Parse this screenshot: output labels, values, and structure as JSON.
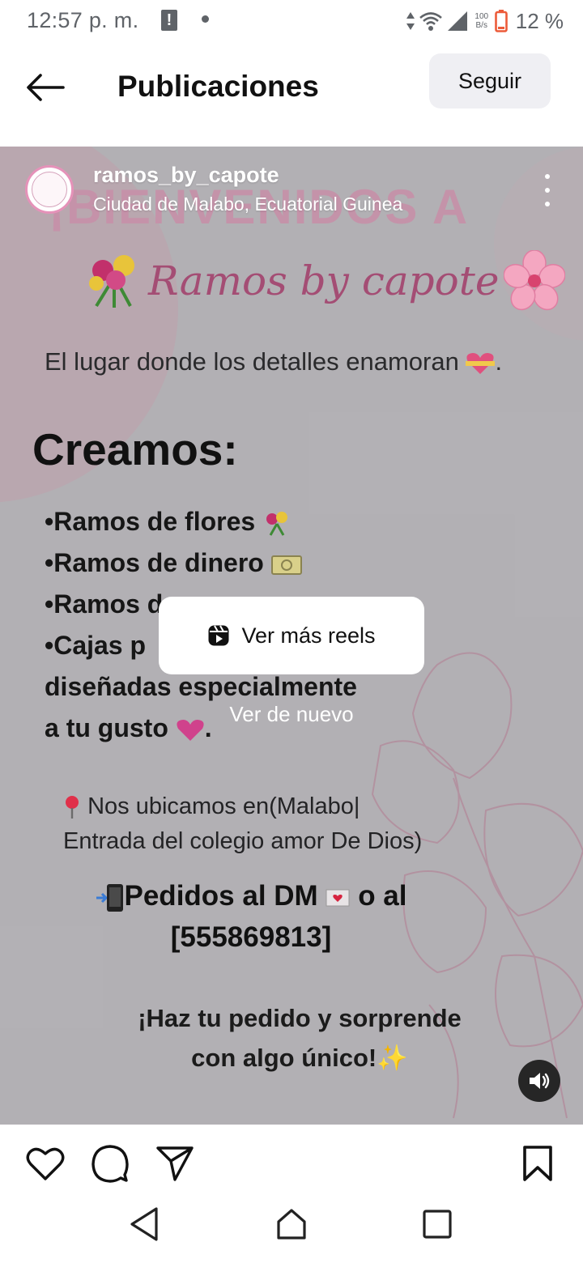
{
  "status_bar": {
    "time": "12:57 p. m.",
    "alert_glyph": "!",
    "net_speed_value": "100",
    "net_speed_unit": "B/s",
    "battery_percent": "12 %",
    "icons": [
      "alert-icon",
      "data-arrows-icon",
      "wifi-icon",
      "signal-icon",
      "battery-low-icon"
    ]
  },
  "header": {
    "title": "Publicaciones",
    "follow_label": "Seguir",
    "back_icon": "arrow-left-icon"
  },
  "post": {
    "username": "ramos_by_capote",
    "location": "Ciudad de Malabo, Ecuatorial Guinea",
    "image": {
      "welcome": "¡BIENVENIDOS A",
      "brand": "Ramos by capote",
      "tagline": "El lugar donde los detalles enamoran",
      "heading": "Creamos:",
      "services": [
        "•Ramos de flores",
        "•Ramos de dinero",
        "•Ramos d",
        "•Cajas p"
      ],
      "services_tail": [
        "diseñadas especialmente",
        "a tu gusto"
      ],
      "location_lines": [
        "Nos ubicamos en(Malabo|",
        "Entrada del colegio amor De Dios)"
      ],
      "orders_lines": [
        "Pedidos al DM",
        "o al",
        "[555869813]"
      ],
      "cta_lines": [
        "¡Haz tu pedido y sorprende",
        "con algo único!"
      ]
    },
    "overlay": {
      "reels_label": "Ver más reels",
      "replay_label": "Ver de nuevo"
    }
  },
  "actions": {
    "icons": [
      "heart-icon",
      "comment-icon",
      "share-icon",
      "bookmark-icon"
    ]
  },
  "colors": {
    "accent_pink": "#e592b9",
    "brand_magenta": "#a44d74",
    "follow_bg": "#efeff3",
    "battery_low": "#ec5b3a"
  }
}
